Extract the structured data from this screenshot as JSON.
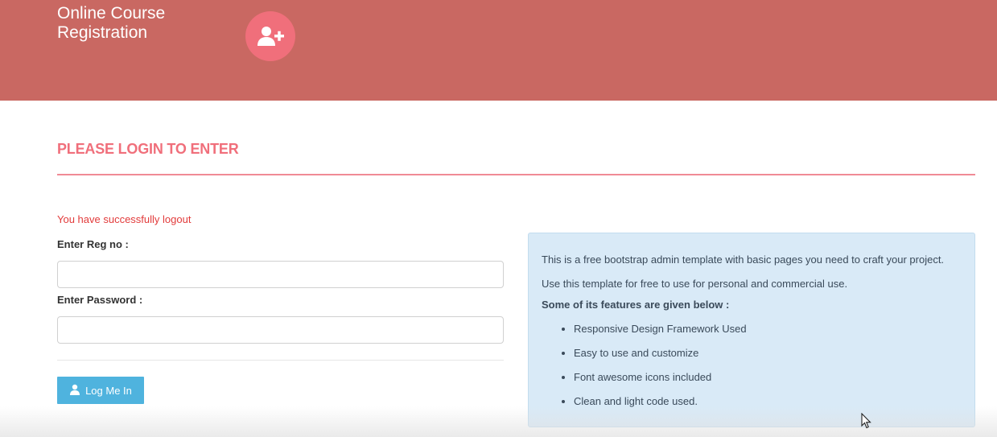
{
  "header": {
    "title_line1": "Online Course",
    "title_line2": "Registration",
    "logo_icon": "user-plus-icon",
    "background_color": "#c96862",
    "accent_color": "#f06f7b"
  },
  "login": {
    "page_title": "PLEASE LOGIN TO ENTER",
    "status_message": "You have successfully logout",
    "reg_no_label": "Enter Reg no :",
    "reg_no_value": "",
    "password_label": "Enter Password :",
    "password_value": "",
    "button_label": "Log Me In",
    "button_icon": "user-icon",
    "button_color": "#4fb3de"
  },
  "info": {
    "text": "This is a free bootstrap admin template with basic pages you need to craft your project. Use this template for free to use for personal and commercial use.",
    "features_title": "Some of its features are given below :",
    "features": [
      "Responsive Design Framework Used",
      "Easy to use and customize",
      "Font awesome icons included",
      "Clean and light code used."
    ]
  }
}
